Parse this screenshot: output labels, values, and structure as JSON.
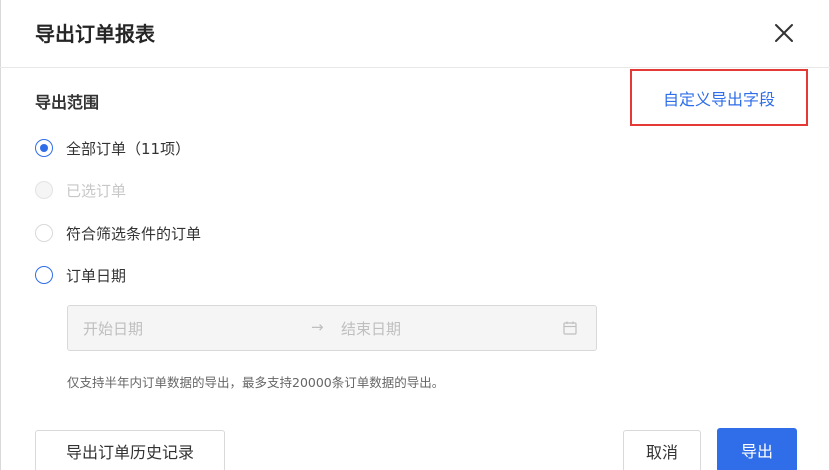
{
  "dialog": {
    "title": "导出订单报表",
    "close_icon": "close-icon"
  },
  "scope": {
    "title": "导出范围",
    "custom_fields_link": "自定义导出字段",
    "highlight_color": "#e53935",
    "accent_color": "#2f6ee8",
    "options": [
      {
        "label": "全部订单（11项）",
        "state": "checked"
      },
      {
        "label": "已选订单",
        "state": "disabled"
      },
      {
        "label": "符合筛选条件的订单",
        "state": "unchecked"
      },
      {
        "label": "订单日期",
        "state": "unchecked"
      }
    ]
  },
  "date_range": {
    "start_placeholder": "开始日期",
    "separator": "→",
    "end_placeholder": "结束日期",
    "icon": "calendar-icon"
  },
  "note": "仅支持半年内订单数据的导出，最多支持20000条订单数据的导出。",
  "footer": {
    "history_button": "导出订单历史记录",
    "cancel_button": "取消",
    "export_button": "导出"
  }
}
